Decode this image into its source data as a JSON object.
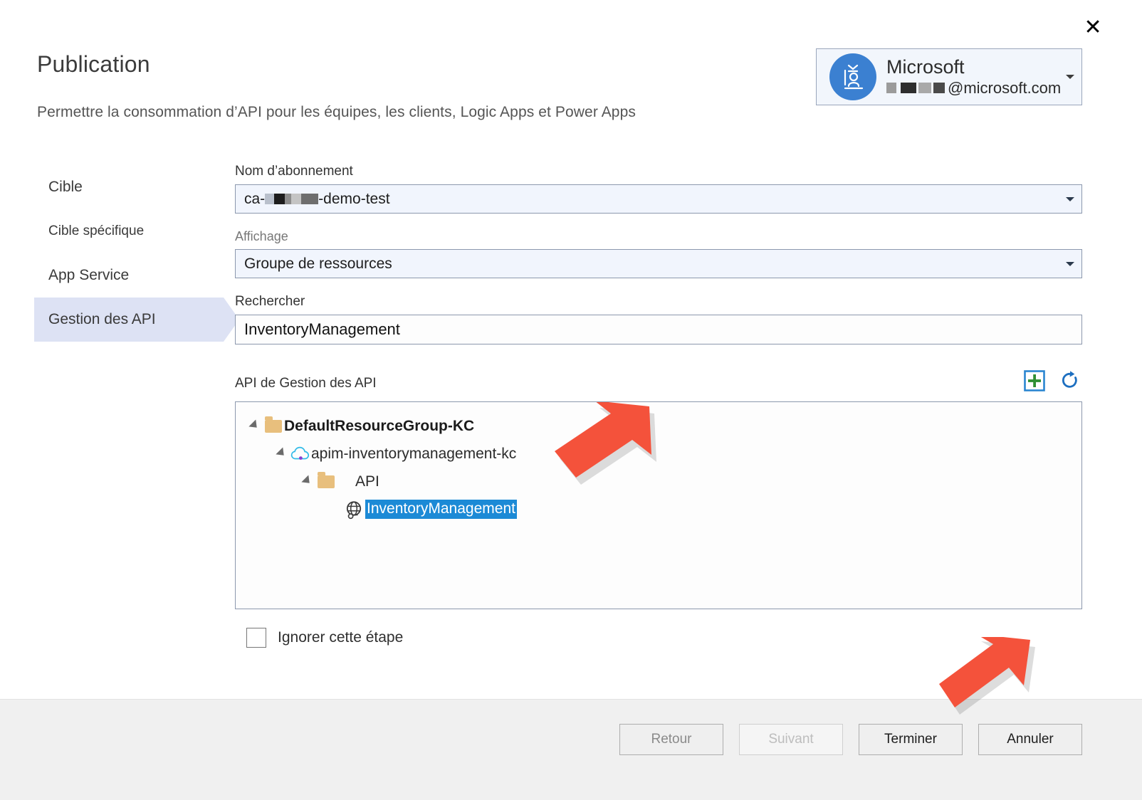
{
  "window": {
    "close_label": "✕",
    "title": "Publication",
    "subtitle": "Permettre la consommation d’API pour les équipes, les clients, Logic Apps et Power Apps"
  },
  "account": {
    "name": "Microsoft",
    "email_suffix": "@microsoft.com",
    "avatar_icon": "user-badge-icon",
    "caret_icon": "chevron-down-icon"
  },
  "sidebar": {
    "items": [
      {
        "label": "Cible",
        "selected": false,
        "indented": false
      },
      {
        "label": "Cible spécifique",
        "selected": false,
        "indented": true
      },
      {
        "label": "App Service",
        "selected": false,
        "indented": false
      },
      {
        "label": "Gestion des API",
        "selected": true,
        "indented": false
      }
    ]
  },
  "form": {
    "subscription": {
      "label": "Nom d’abonnement",
      "value_prefix": "ca-",
      "value_suffix": "-demo-test",
      "caret_icon": "chevron-down-icon"
    },
    "display": {
      "label": "Affichage",
      "value": "Groupe de ressources",
      "caret_icon": "chevron-down-icon"
    },
    "search": {
      "label": "Rechercher",
      "value": "InventoryManagement",
      "placeholder": ""
    },
    "tree": {
      "caption": "API de Gestion des API",
      "add_icon": "plus-icon",
      "refresh_icon": "refresh-icon",
      "nodes": [
        {
          "label": "DefaultResourceGroup-KC",
          "icon": "folder-icon",
          "depth": 0,
          "expanded": true,
          "bold": true,
          "selected": false
        },
        {
          "label": "apim-inventorymanagement-kc",
          "icon": "cloud-icon",
          "depth": 1,
          "expanded": true,
          "bold": false,
          "selected": false
        },
        {
          "label": "API",
          "icon": "folder-icon",
          "depth": 2,
          "expanded": true,
          "bold": false,
          "selected": false
        },
        {
          "label": "InventoryManagement",
          "icon": "globe-icon",
          "depth": 3,
          "expanded": false,
          "bold": false,
          "selected": true
        }
      ]
    },
    "skip_step": {
      "label": "Ignorer cette étape",
      "checked": false
    }
  },
  "footer": {
    "buttons": [
      {
        "label": "Retour",
        "state": "dim"
      },
      {
        "label": "Suivant",
        "state": "disabled"
      },
      {
        "label": "Terminer",
        "state": "normal"
      },
      {
        "label": "Annuler",
        "state": "normal"
      }
    ]
  },
  "colors": {
    "selection_blue": "#1c8ad6",
    "nav_selected": "#dde2f4",
    "avatar_blue": "#3b80d1",
    "annotation_red": "#f4523b",
    "plus_green": "#2f8f33",
    "plus_border_blue": "#2a85d0",
    "refresh_blue": "#1d6fc0"
  },
  "annotations": {
    "arrow_tree_name": "red-arrow-pointing-to-selected-api",
    "arrow_finish_button": "red-arrow-pointing-to-terminer-button"
  }
}
